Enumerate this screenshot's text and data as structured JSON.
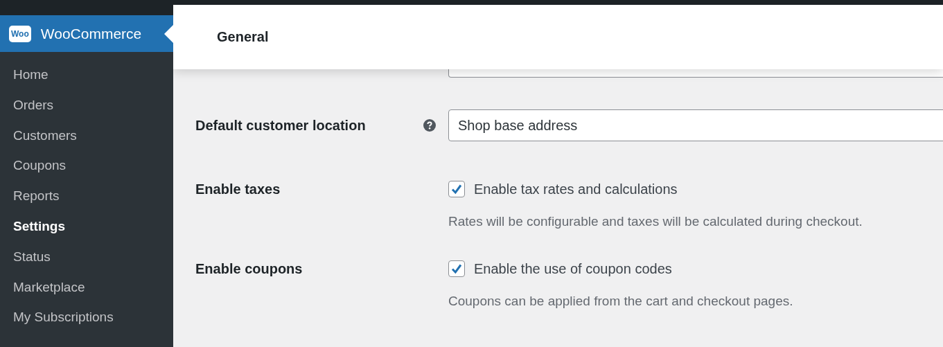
{
  "sidebar": {
    "logo_text": "Woo",
    "title": "WooCommerce",
    "items": [
      {
        "label": "Home",
        "selected": false
      },
      {
        "label": "Orders",
        "selected": false
      },
      {
        "label": "Customers",
        "selected": false
      },
      {
        "label": "Coupons",
        "selected": false
      },
      {
        "label": "Reports",
        "selected": false
      },
      {
        "label": "Settings",
        "selected": true
      },
      {
        "label": "Status",
        "selected": false
      },
      {
        "label": "Marketplace",
        "selected": false
      },
      {
        "label": "My Subscriptions",
        "selected": false
      }
    ]
  },
  "header": {
    "title": "General"
  },
  "settings": [
    {
      "kind": "select",
      "label": "Default customer location",
      "help": true,
      "value": "Shop base address"
    },
    {
      "kind": "checkbox",
      "label": "Enable taxes",
      "checkbox_label": "Enable tax rates and calculations",
      "checked": true,
      "description": "Rates will be configurable and taxes will be calculated during checkout."
    },
    {
      "kind": "checkbox",
      "label": "Enable coupons",
      "checkbox_label": "Enable the use of coupon codes",
      "checked": true,
      "description": "Coupons can be applied from the cart and checkout pages."
    }
  ]
}
